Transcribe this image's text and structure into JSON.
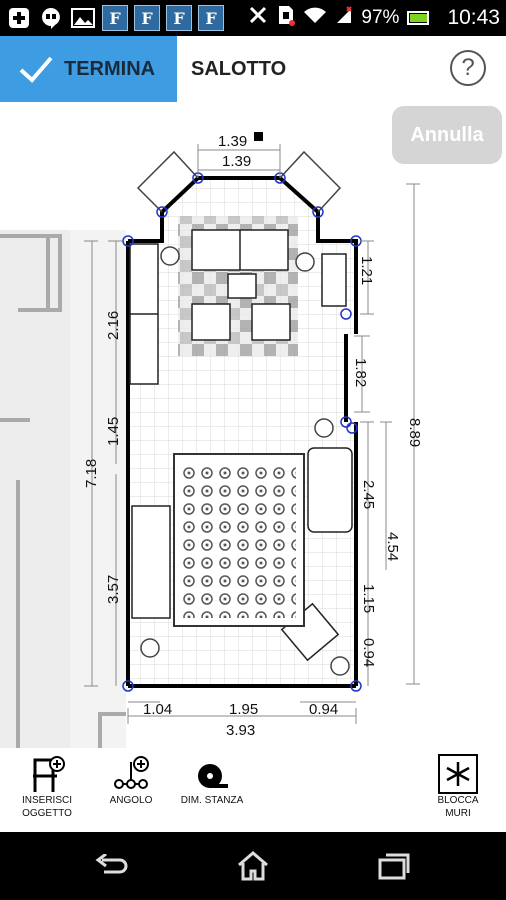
{
  "status_bar": {
    "battery_percent": "97%",
    "time": "10:43",
    "notification_icons": [
      "plus-icon",
      "hangouts-icon",
      "image-icon",
      "app-icon",
      "app-icon",
      "app-icon",
      "app-icon"
    ],
    "app_icon_letter": "F"
  },
  "header": {
    "done_label": "TERMINA",
    "room_title": "SALOTTO",
    "help_label": "?"
  },
  "canvas": {
    "undo_label": "Annulla",
    "dimensions": {
      "top_locked": "1.39",
      "top_inner": "1.39",
      "right_upper": "1.21",
      "right_middle": "1.82",
      "right_total": "8.89",
      "left_upper": "2.16",
      "left_middle": "1.45",
      "left_total": "7.18",
      "left_lower": "3.57",
      "right_lower_a": "2.45",
      "right_lower_total": "4.54",
      "right_lower_b": "1.15",
      "right_lower_c": "0.94",
      "bottom_left": "1.04",
      "bottom_middle": "1.95",
      "bottom_right": "0.94",
      "bottom_total": "3.93"
    }
  },
  "toolbar": {
    "insert_object": "INSERISCI\nOGGETTO",
    "corner": "ANGOLO",
    "room_dim": "DIM. STANZA",
    "lock_walls": "BLOCCA\nMURI"
  }
}
